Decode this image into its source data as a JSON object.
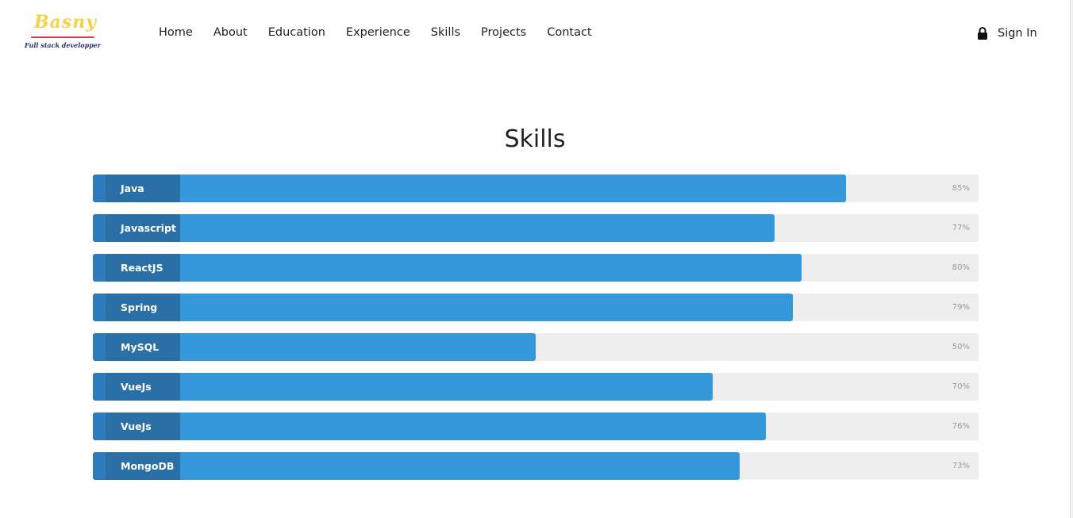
{
  "header": {
    "logo": {
      "name": "Basny",
      "tagline": "Full stack developper"
    },
    "nav": [
      {
        "label": "Home"
      },
      {
        "label": "About"
      },
      {
        "label": "Education"
      },
      {
        "label": "Experience"
      },
      {
        "label": "Skills"
      },
      {
        "label": "Projects"
      },
      {
        "label": "Contact"
      }
    ],
    "signin": {
      "label": "Sign In",
      "icon": "lock-icon"
    }
  },
  "skills_section": {
    "title": "Skills",
    "items": [
      {
        "name": "Java",
        "percent": 85,
        "percent_label": "85%"
      },
      {
        "name": "Javascript",
        "percent": 77,
        "percent_label": "77%"
      },
      {
        "name": "ReactJS",
        "percent": 80,
        "percent_label": "80%"
      },
      {
        "name": "Spring",
        "percent": 79,
        "percent_label": "79%"
      },
      {
        "name": "MySQL",
        "percent": 50,
        "percent_label": "50%"
      },
      {
        "name": "VueJs",
        "percent": 70,
        "percent_label": "70%"
      },
      {
        "name": "VueJs",
        "percent": 76,
        "percent_label": "76%"
      },
      {
        "name": "MongoDB",
        "percent": 73,
        "percent_label": "73%"
      }
    ]
  },
  "colors": {
    "bar_fill": "#3498db",
    "label_bg": "#2a6fa5",
    "track_bg": "#eeeeee",
    "logo_yellow": "#f5d247",
    "logo_red": "#e8334a",
    "logo_navy": "#2b2f6b"
  }
}
